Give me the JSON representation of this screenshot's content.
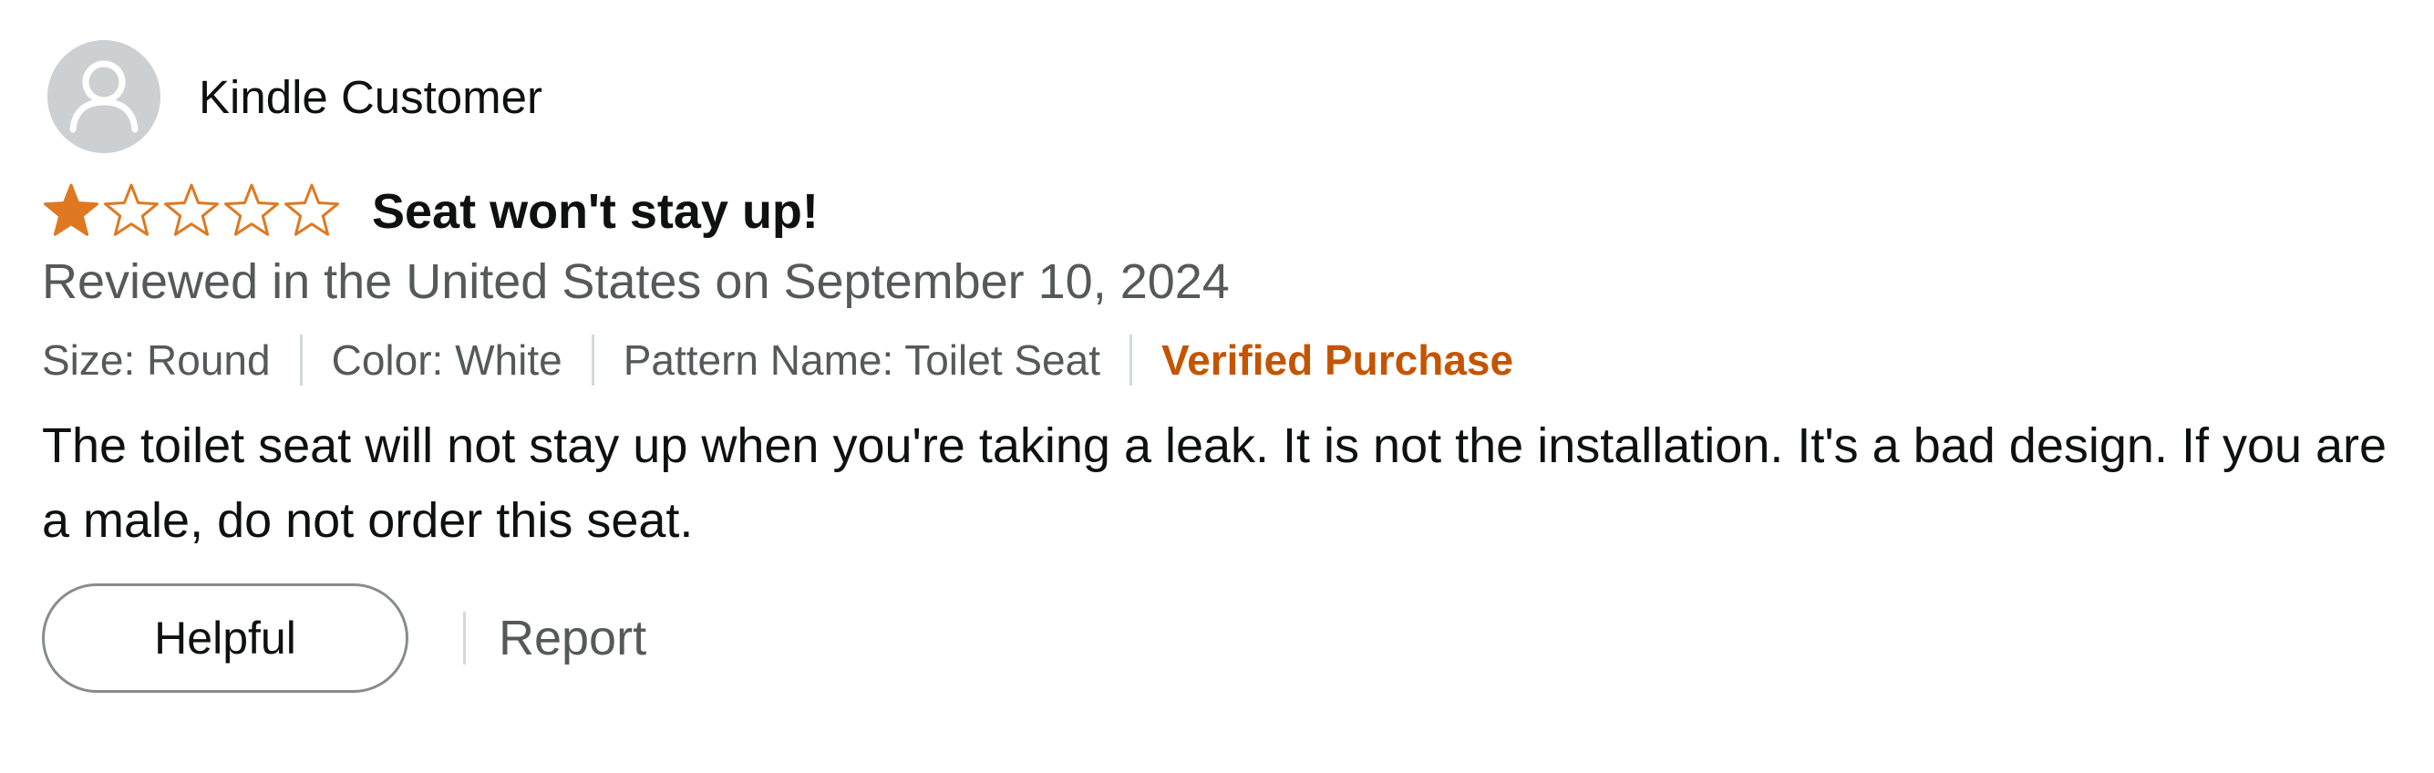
{
  "profile": {
    "name": "Kindle Customer",
    "avatar_icon": "default-user-avatar-icon"
  },
  "rating": {
    "value": 1,
    "max": 5,
    "filled_color": "#de7921",
    "empty_color": "#de7921"
  },
  "review": {
    "title": "Seat won't stay up!",
    "date_line": "Reviewed in the United States on September 10, 2024",
    "body": "The toilet seat will not stay up when you're taking a leak. It is not the installation. It's a bad design. If you are a male, do not order this seat."
  },
  "variations": {
    "size": "Size: Round",
    "color": "Color: White",
    "pattern": "Pattern Name: Toilet Seat",
    "verified": "Verified Purchase",
    "verified_color": "#c45500"
  },
  "actions": {
    "helpful_label": "Helpful",
    "report_label": "Report"
  }
}
